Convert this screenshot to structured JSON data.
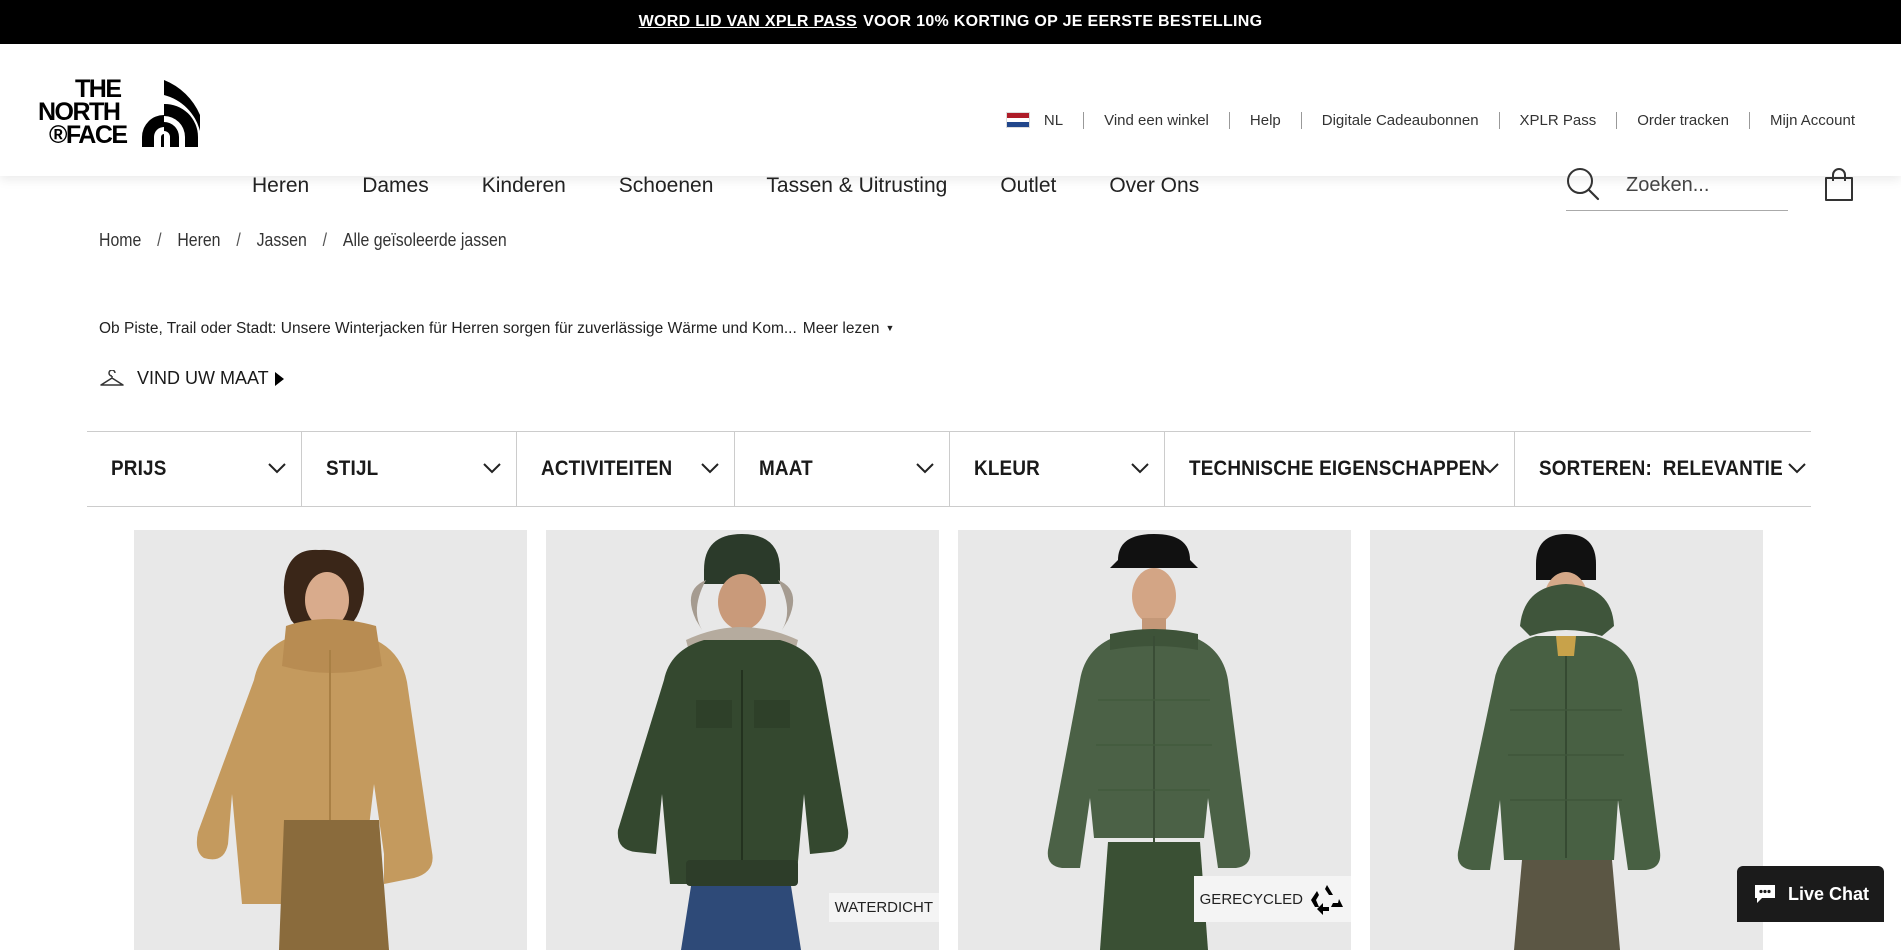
{
  "promo": {
    "link_text": "WORD LID VAN XPLR PASS",
    "text": "VOOR 10% KORTING OP JE EERSTE BESTELLING"
  },
  "brand": {
    "logo_lines": [
      "THE",
      "NORTH",
      "®FACE"
    ]
  },
  "utility": {
    "language": "NL",
    "items": [
      "Vind een winkel",
      "Help",
      "Digitale Cadeaubonnen",
      "XPLR Pass",
      "Order tracken",
      "Mijn Account"
    ]
  },
  "nav": {
    "items": [
      "Heren",
      "Dames",
      "Kinderen",
      "Schoenen",
      "Tassen & Uitrusting",
      "Outlet",
      "Over Ons"
    ]
  },
  "search": {
    "placeholder": "Zoeken..."
  },
  "icons": {
    "search": "search-icon",
    "bag": "shopping-bag-icon",
    "hanger": "hanger-icon",
    "chevron": "chevron-down-icon",
    "chat": "chat-bubble-icon",
    "recycle": "recycle-icon",
    "flag": "netherlands-flag-icon"
  },
  "breadcrumb": [
    "Home",
    "Heren",
    "Jassen",
    "Alle geïsoleerde jassen"
  ],
  "description": {
    "text": "Ob Piste, Trail oder Stadt: Unsere Winterjacken für Herren sorgen für zuverlässige Wärme und Kom...",
    "more": "Meer lezen"
  },
  "find_size": {
    "label": "VIND UW MAAT"
  },
  "filters": [
    "PRIJS",
    "STIJL",
    "ACTIVITEITEN",
    "MAAT",
    "KLEUR",
    "TECHNISCHE EIGENSCHAPPEN",
    "SORTEREN:  RELEVANTIE"
  ],
  "products": [
    {
      "badge": ""
    },
    {
      "badge": "WATERDICHT"
    },
    {
      "badge": "GERECYCLED"
    },
    {
      "badge": ""
    }
  ],
  "chat": {
    "label": "Live Chat"
  },
  "colors": {
    "jacket_tan": "#c49a5e",
    "jacket_green": "#3b5236",
    "background_card": "#e8e8e8",
    "promo_bar": "#000000"
  }
}
